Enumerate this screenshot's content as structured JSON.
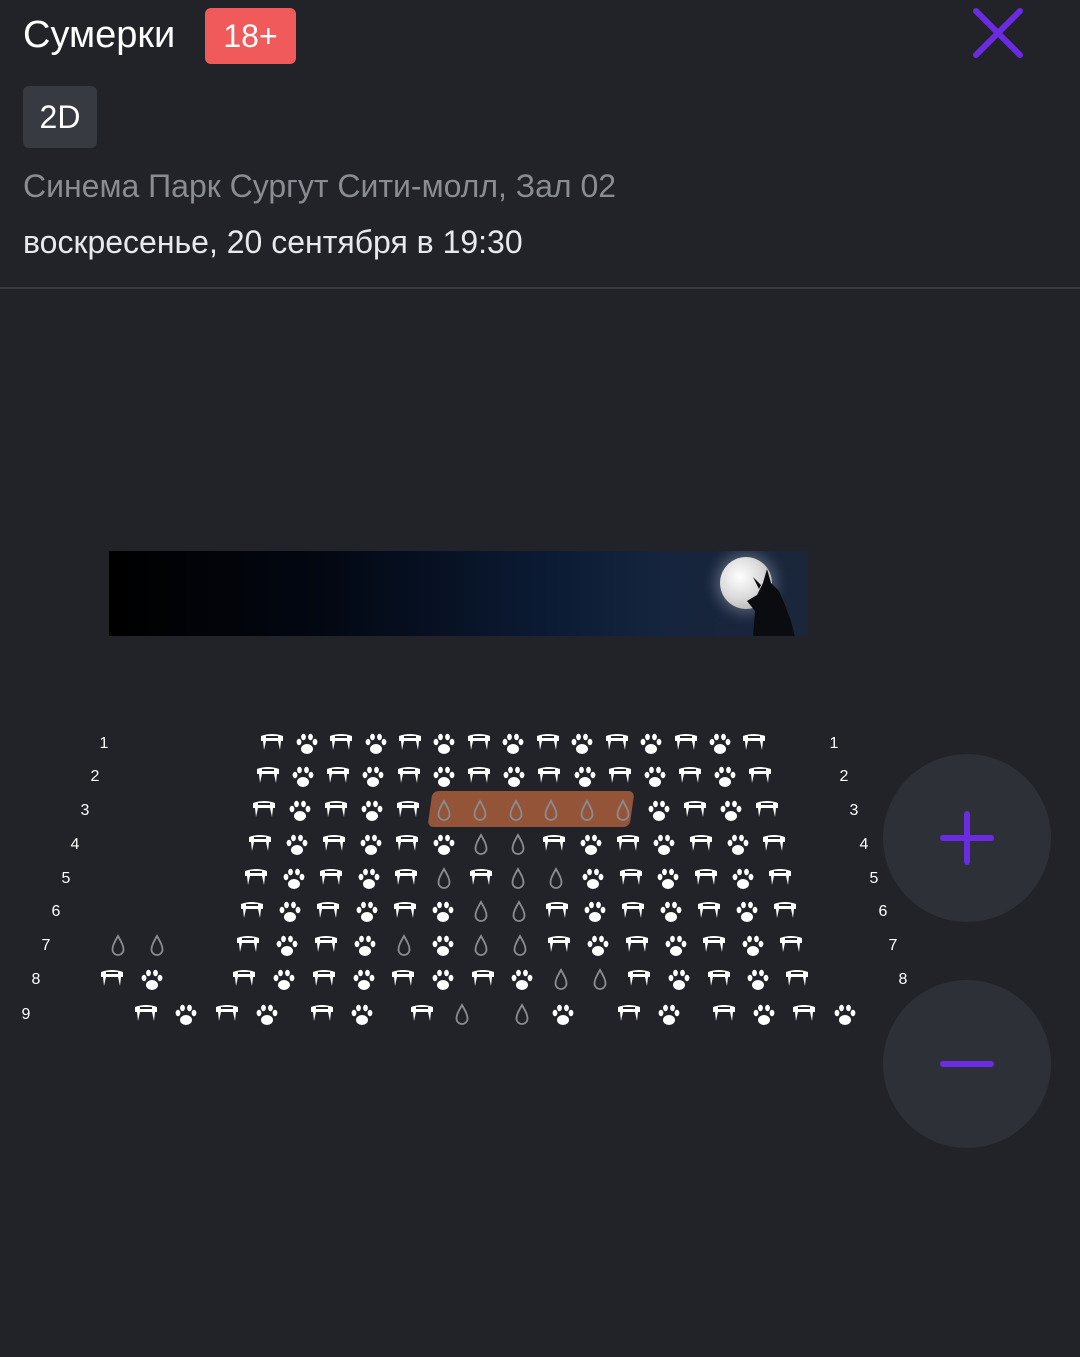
{
  "header": {
    "title": "Сумерки",
    "age_rating": "18+",
    "format": "2D",
    "cinema": "Синема Парк Сургут Сити-молл, Зал 02",
    "datetime": "воскресенье, 20 сентября в 19:30",
    "close_icon": "close-icon"
  },
  "colors": {
    "background": "#212329",
    "accent": "#6a2be2",
    "age_badge": "#f05a5a",
    "selection": "#9b5738",
    "seat_taken": "#ffffff",
    "seat_free": "#8a8c93"
  },
  "hall": {
    "screen_image": "twilight-moon-wolf-banner",
    "rows": [
      {
        "label": "1",
        "seats": [
          "fang",
          "paw",
          "fang",
          "paw",
          "fang",
          "paw",
          "fang",
          "paw",
          "fang",
          "paw",
          "fang",
          "paw",
          "fang",
          "paw",
          "fang"
        ]
      },
      {
        "label": "2",
        "seats": [
          "fang",
          "paw",
          "fang",
          "paw",
          "fang",
          "paw",
          "fang",
          "paw",
          "fang",
          "paw",
          "fang",
          "paw",
          "fang",
          "paw",
          "fang"
        ]
      },
      {
        "label": "3",
        "seats": [
          "fang",
          "paw",
          "fang",
          "paw",
          "fang",
          "drop",
          "drop",
          "drop",
          "drop",
          "drop",
          "drop",
          "paw",
          "fang",
          "paw",
          "fang"
        ]
      },
      {
        "label": "4",
        "seats": [
          "fang",
          "paw",
          "fang",
          "paw",
          "fang",
          "paw",
          "drop",
          "drop",
          "fang",
          "paw",
          "fang",
          "paw",
          "fang",
          "paw",
          "fang"
        ]
      },
      {
        "label": "5",
        "seats": [
          "fang",
          "paw",
          "fang",
          "paw",
          "fang",
          "drop",
          "fang",
          "drop",
          "drop",
          "paw",
          "fang",
          "paw",
          "fang",
          "paw",
          "fang"
        ]
      },
      {
        "label": "6",
        "seats": [
          "fang",
          "paw",
          "fang",
          "paw",
          "fang",
          "paw",
          "drop",
          "drop",
          "fang",
          "paw",
          "fang",
          "paw",
          "fang",
          "paw",
          "fang"
        ]
      },
      {
        "label": "7",
        "seats": [
          "drop",
          "drop",
          "fang",
          "paw",
          "fang",
          "paw",
          "drop",
          "paw",
          "drop",
          "drop",
          "fang",
          "paw",
          "fang",
          "paw",
          "fang",
          "paw",
          "fang"
        ]
      },
      {
        "label": "8",
        "seats": [
          "fang",
          "paw",
          "fang",
          "paw",
          "fang",
          "paw",
          "fang",
          "paw",
          "fang",
          "paw",
          "drop",
          "drop",
          "fang",
          "paw",
          "fang",
          "paw",
          "fang"
        ]
      },
      {
        "label": "9",
        "seats": [
          "fang",
          "paw",
          "fang",
          "paw",
          "fang",
          "paw",
          "fang",
          "drop",
          "drop",
          "paw",
          "fang",
          "paw",
          "fang",
          "paw",
          "fang",
          "paw"
        ]
      }
    ],
    "selected_seats": {
      "row": "3",
      "count": 6
    }
  },
  "controls": {
    "zoom_in": "plus-icon",
    "zoom_out": "minus-icon"
  }
}
